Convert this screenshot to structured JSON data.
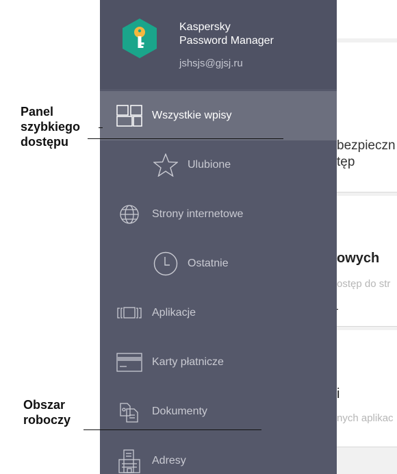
{
  "app": {
    "name_line1": "Kaspersky",
    "name_line2": "Password Manager",
    "email": "jshsjs@gjsj.ru"
  },
  "nav": {
    "items": [
      {
        "label": "Wszystkie wpisy",
        "icon": "grid-icon",
        "active": true
      },
      {
        "label": "Ulubione",
        "icon": "star-icon"
      },
      {
        "label": "Strony internetowe",
        "icon": "globe-icon"
      },
      {
        "label": "Ostatnie",
        "icon": "clock-icon"
      },
      {
        "label": "Aplikacje",
        "icon": "app-window-icon"
      },
      {
        "label": "Karty płatnicze",
        "icon": "credit-card-icon"
      },
      {
        "label": "Dokumenty",
        "icon": "documents-icon"
      },
      {
        "label": "Adresy",
        "icon": "building-icon"
      }
    ]
  },
  "background": {
    "card1_line1": "bezpieczn",
    "card1_line2": "tęp",
    "card2_title": "owych",
    "card2_sub": "ostęp do str",
    "card3_title": "i",
    "card3_sub": "nych aplikac"
  },
  "annotations": {
    "quick_access_line1": "Panel",
    "quick_access_line2": "szybkiego",
    "quick_access_line3": "dostępu",
    "workspace_line1": "Obszar",
    "workspace_line2": "roboczy"
  },
  "colors": {
    "drawer_bg": "#55586a",
    "active_bg": "#6c6f7e",
    "logo_green": "#1aa58b",
    "key_yellow": "#f5b73e"
  }
}
